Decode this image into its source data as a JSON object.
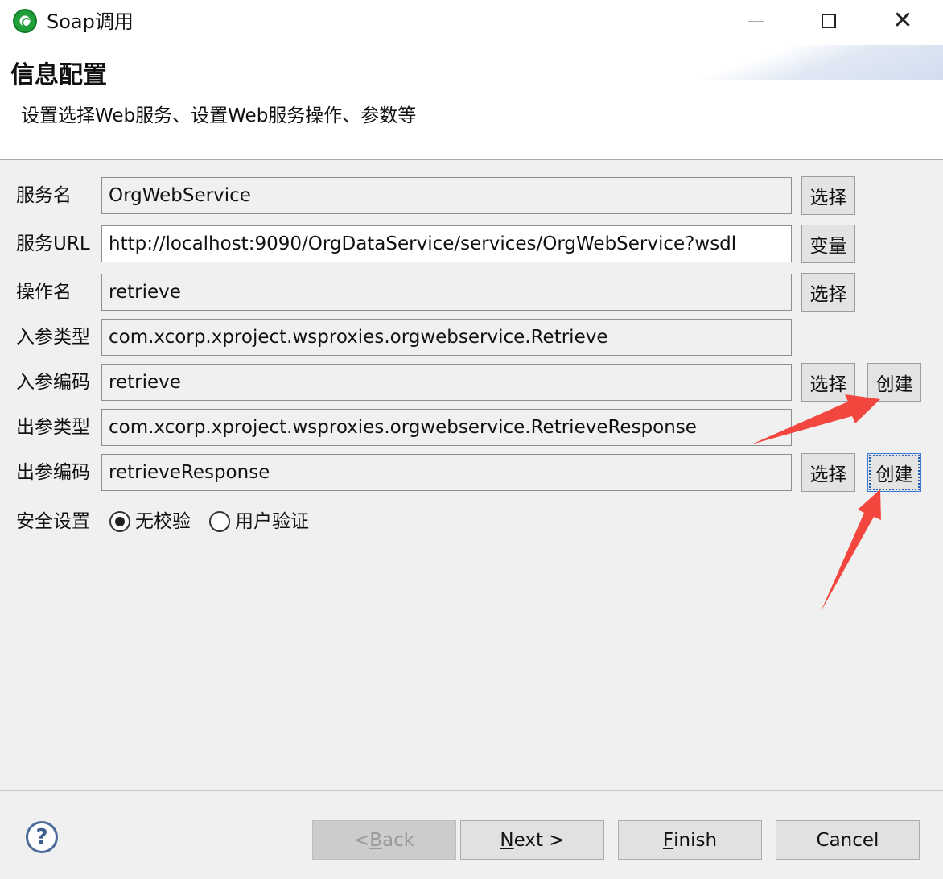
{
  "window": {
    "title": "Soap调用",
    "minimize_label": "—",
    "close_label": "✕"
  },
  "banner": {
    "title": "信息配置",
    "subtitle": "设置选择Web服务、设置Web服务操作、参数等"
  },
  "form": {
    "fields": [
      {
        "label": "服务名",
        "value": "OrgWebService",
        "button": "选择"
      },
      {
        "label": "服务URL",
        "value": "http://localhost:9090/OrgDataService/services/OrgWebService?wsdl",
        "button": "变量"
      },
      {
        "label": "操作名",
        "value": "retrieve",
        "button": "选择"
      },
      {
        "label": "入参类型",
        "value": "com.xcorp.xproject.wsproxies.orgwebservice.Retrieve"
      },
      {
        "label": "入参编码",
        "value": "retrieve",
        "button": "选择",
        "create_button": "创建"
      },
      {
        "label": "出参类型",
        "value": "com.xcorp.xproject.wsproxies.orgwebservice.RetrieveResponse"
      },
      {
        "label": "出参编码",
        "value": "retrieveResponse",
        "button": "选择",
        "create_button": "创建"
      }
    ],
    "security": {
      "label": "安全设置",
      "options": [
        {
          "label": "无校验",
          "checked": true
        },
        {
          "label": "用户验证",
          "checked": false
        }
      ]
    }
  },
  "footer": {
    "help_label": "?",
    "back": {
      "prefix": "< ",
      "mnemonic": "B",
      "rest": "ack",
      "enabled": false
    },
    "next": {
      "mnemonic": "N",
      "rest": "ext >"
    },
    "finish": {
      "mnemonic": "F",
      "rest": "inish"
    },
    "cancel": "Cancel"
  },
  "colors": {
    "annotation_arrow": "#f2463f",
    "focus_outline": "#1f5fb8"
  }
}
